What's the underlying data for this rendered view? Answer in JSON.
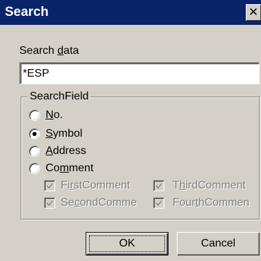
{
  "window": {
    "title": "Search",
    "close_glyph": "✕"
  },
  "search": {
    "label_pre": "Search ",
    "label_mnemonic": "d",
    "label_post": "ata",
    "value": "*ESP"
  },
  "search_field": {
    "legend": "SearchField",
    "selected": "Symbol",
    "options": [
      {
        "pre": "",
        "mnemonic": "N",
        "post": "o.",
        "checked": false
      },
      {
        "pre": "",
        "mnemonic": "S",
        "post": "ymbol",
        "checked": true
      },
      {
        "pre": "",
        "mnemonic": "A",
        "post": "ddress",
        "checked": false
      },
      {
        "pre": "Co",
        "mnemonic": "m",
        "post": "ment",
        "checked": false
      }
    ],
    "comment_checkboxes": [
      {
        "pre": "Fi",
        "mnemonic": "r",
        "post": "stComment",
        "checked": true,
        "enabled": false
      },
      {
        "pre": "T",
        "mnemonic": "h",
        "post": "irdComment",
        "checked": true,
        "enabled": false
      },
      {
        "pre": "Se",
        "mnemonic": "c",
        "post": "ondComme",
        "checked": true,
        "enabled": false
      },
      {
        "pre": "Four",
        "mnemonic": "t",
        "post": "hCommen",
        "checked": true,
        "enabled": false
      }
    ]
  },
  "buttons": {
    "ok": "OK",
    "cancel": "Cancel"
  },
  "colors": {
    "title_bar": "#0a246a",
    "dialog_face": "#d4d0c8",
    "disabled_text": "#808080"
  }
}
